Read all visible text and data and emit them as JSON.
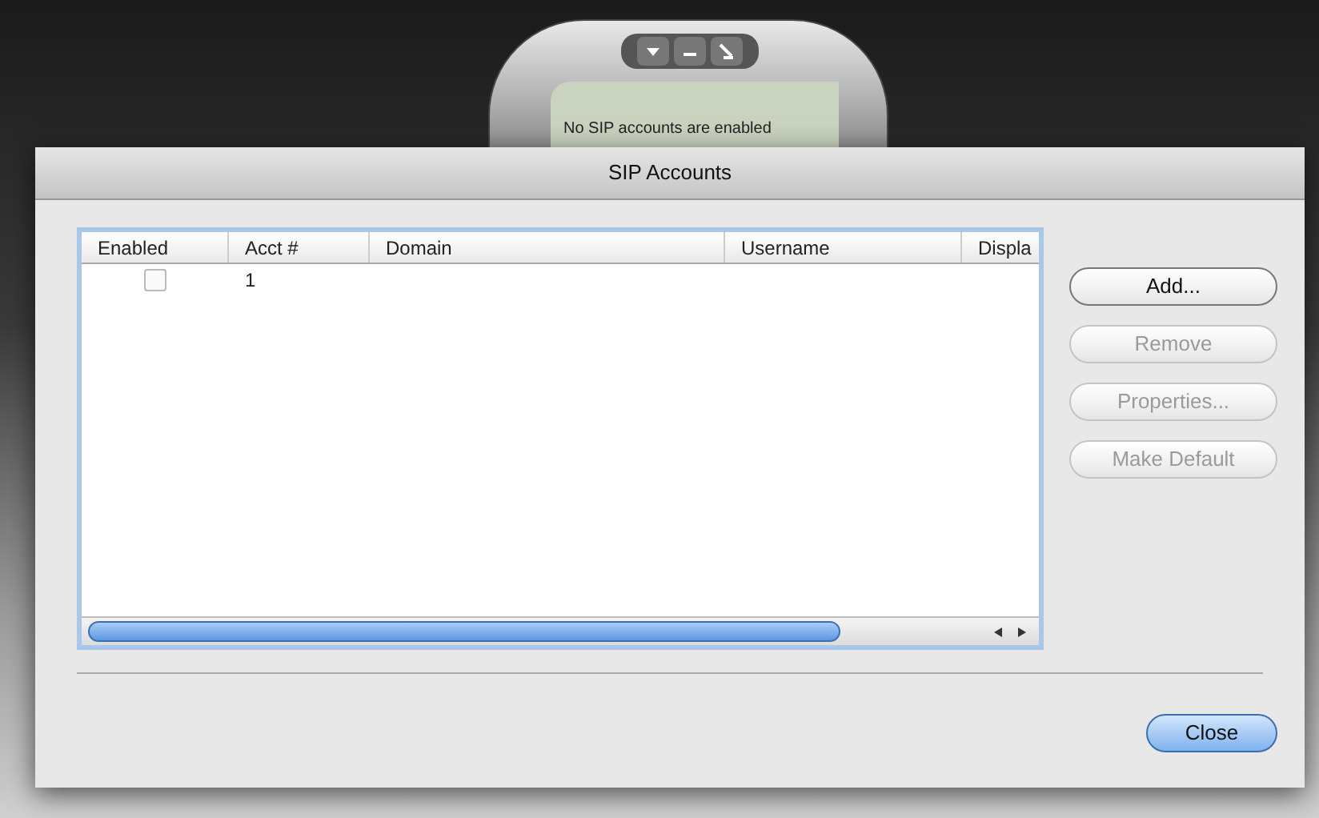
{
  "phone_window": {
    "status": "No SIP accounts are enabled"
  },
  "dialog": {
    "title": "SIP Accounts",
    "table": {
      "columns": [
        "Enabled",
        "Acct #",
        "Domain",
        "Username",
        "Displa"
      ],
      "rows": [
        {
          "enabled": false,
          "acct": "1"
        }
      ]
    },
    "side_buttons": [
      {
        "label": "Add...",
        "disabled": false
      },
      {
        "label": "Remove",
        "disabled": true
      },
      {
        "label": "Properties...",
        "disabled": true
      },
      {
        "label": "Make Default",
        "disabled": true
      }
    ],
    "close_button": {
      "label": "Close",
      "default": true
    }
  }
}
